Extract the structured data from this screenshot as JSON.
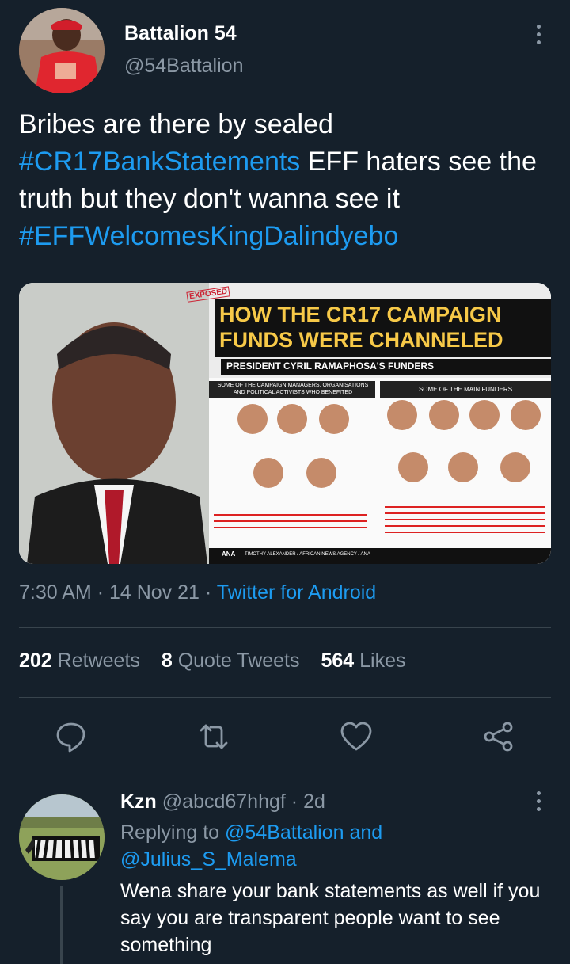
{
  "tweet": {
    "author_name": "Battalion 54",
    "author_handle": "@54Battalion",
    "text_part1": "Bribes are there by sealed ",
    "hashtag1": "#CR17BankStatements",
    "text_part2": " EFF haters see the truth but they don't wanna see it ",
    "hashtag2": "#EFFWelcomesKingDalindyebo",
    "time": "7:30 AM",
    "date": "14 Nov 21",
    "source": "Twitter for Android",
    "stats": {
      "retweets_count": "202",
      "retweets_label": "Retweets",
      "quotes_count": "8",
      "quotes_label": "Quote Tweets",
      "likes_count": "564",
      "likes_label": "Likes"
    }
  },
  "media": {
    "stamp": "EXPOSED",
    "headline_line1": "HOW THE CR17 CAMPAIGN",
    "headline_line2": "FUNDS WERE CHANNELED",
    "subtitle": "PRESIDENT CYRIL RAMAPHOSA'S FUNDERS",
    "left_panel_title": "SOME OF THE CAMPAIGN MANAGERS, ORGANISATIONS AND POLITICAL ACTIVISTS WHO BENEFITED",
    "right_panel_title": "SOME OF THE MAIN FUNDERS",
    "credit": "TIMOTHY ALEXANDER / AFRICAN NEWS AGENCY / ANA",
    "agency_logo": "ANA"
  },
  "reply": {
    "author_name": "Kzn",
    "author_handle": "@abcd67hhgf",
    "age": "2d",
    "replying_prefix": "Replying to ",
    "mention1": "@54Battalion",
    "and_word": " and",
    "mention2": "@Julius_S_Malema",
    "text": "Wena share your bank statements as well if you say you are transparent people want to see something"
  },
  "icons": {
    "reply": "reply-icon",
    "retweet": "retweet-icon",
    "like": "heart-icon",
    "share": "share-icon",
    "more": "more-vertical-icon"
  },
  "colors": {
    "background": "#15202b",
    "accent": "#1d9bf0",
    "muted": "#8b98a5",
    "divider": "#38444d"
  }
}
